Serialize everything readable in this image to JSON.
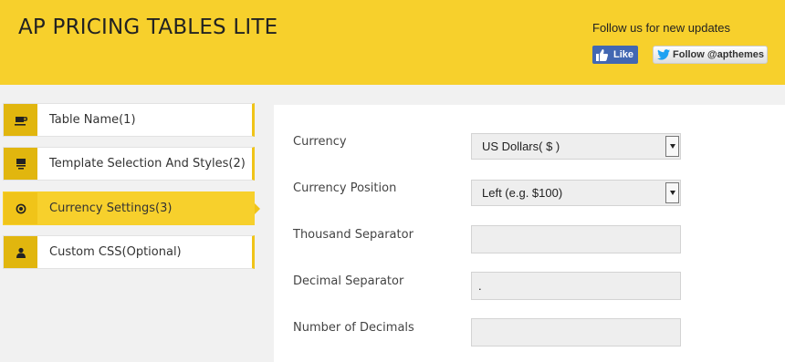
{
  "header": {
    "title": "AP PRICING TABLES LITE",
    "follow_text": "Follow us for new updates",
    "fb_like_label": "Like",
    "twitter_follow_label": "Follow @apthemes",
    "colors": {
      "header_bg": "#f7d02c",
      "fb_blue": "#4267b2"
    }
  },
  "sidebar": {
    "items": [
      {
        "label": "Table Name(1)",
        "icon": "cup-icon",
        "active": false
      },
      {
        "label": "Template Selection And Styles(2)",
        "icon": "layout-icon",
        "active": false
      },
      {
        "label": "Currency Settings(3)",
        "icon": "target-icon",
        "active": true
      },
      {
        "label": "Custom CSS(Optional)",
        "icon": "user-icon",
        "active": false
      }
    ],
    "colors": {
      "active_bg": "#f7d02c",
      "icon_bg": "#e1b60e"
    }
  },
  "form": {
    "currency": {
      "label": "Currency",
      "value": "US Dollars( $ )"
    },
    "currency_position": {
      "label": "Currency Position",
      "value": "Left (e.g. $100)"
    },
    "thousand_separator": {
      "label": "Thousand Separator",
      "value": ""
    },
    "decimal_separator": {
      "label": "Decimal Separator",
      "value": "."
    },
    "number_of_decimals": {
      "label": "Number of Decimals",
      "value": ""
    }
  }
}
